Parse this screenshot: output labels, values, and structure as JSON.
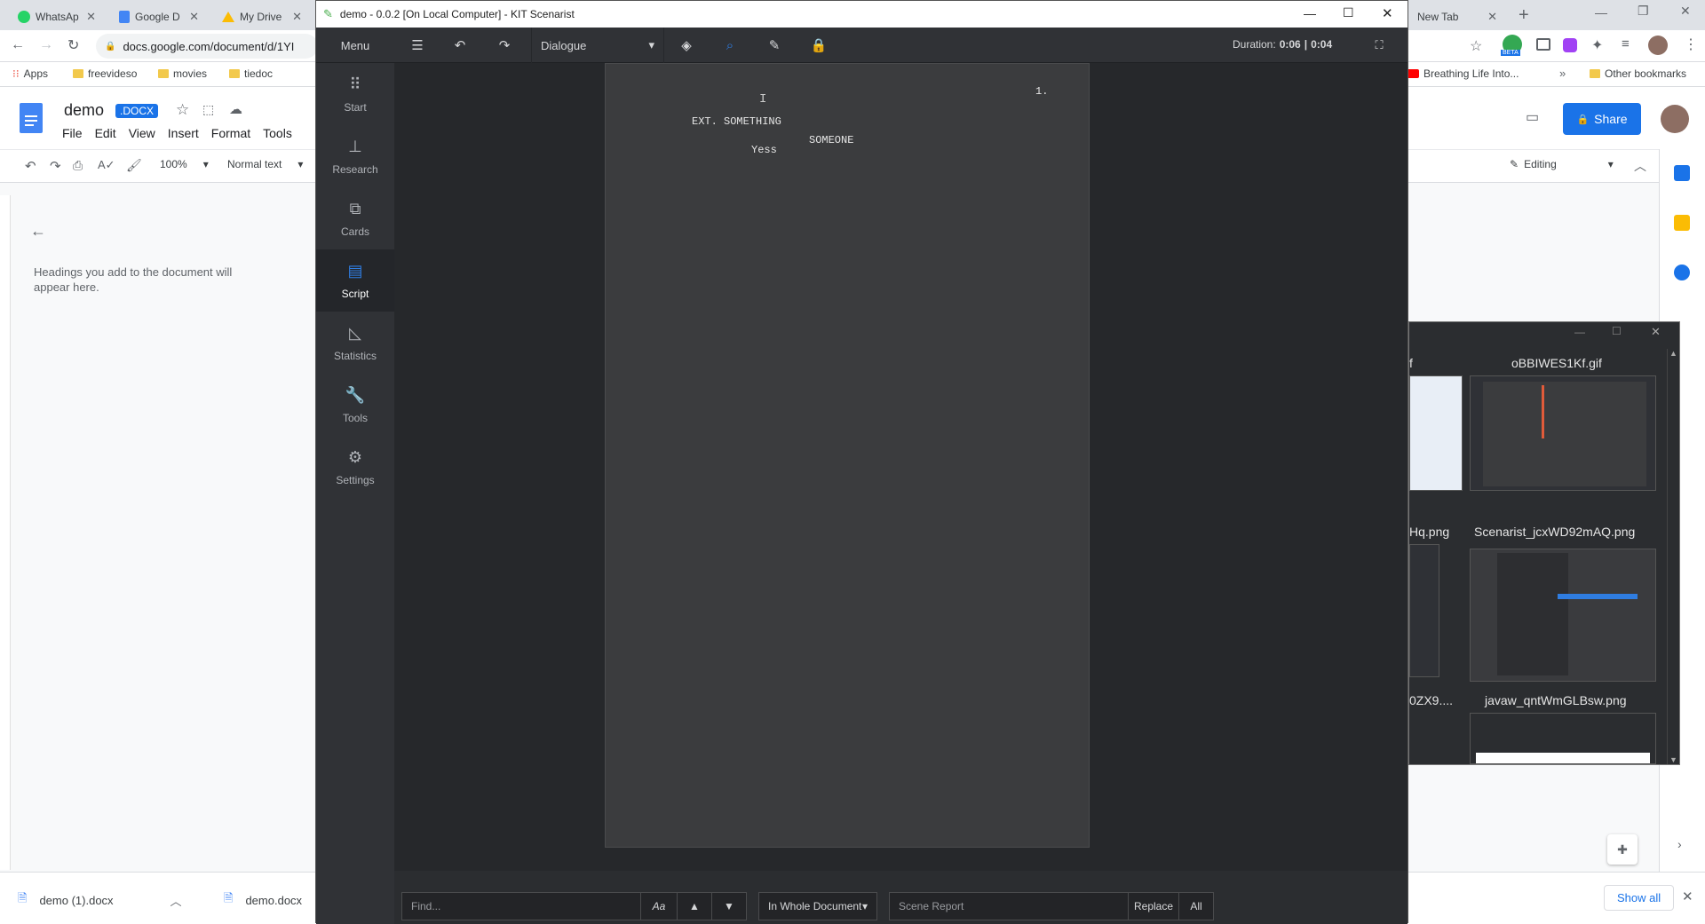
{
  "browser": {
    "tabs": [
      {
        "label": "WhatsAp",
        "color": "#25d366"
      },
      {
        "label": "Google D",
        "color": "#4285f4"
      },
      {
        "label": "My Drive",
        "color": "#fbbc04"
      },
      {
        "label": "New Tab",
        "color": "#9aa0a6"
      }
    ],
    "url": "docs.google.com/document/d/1YI",
    "bookmarks": [
      "Apps",
      "freevideso",
      "movies",
      "tiedoc"
    ],
    "bookmark_right": "Breathing Life Into...",
    "other_bookmarks": "Other bookmarks",
    "beta_badge": "BETA"
  },
  "docs": {
    "title": "demo",
    "ext_badge": ".DOCX",
    "menu": [
      "File",
      "Edit",
      "View",
      "Insert",
      "Format",
      "Tools"
    ],
    "zoom": "100%",
    "style": "Normal text",
    "share_label": "Share",
    "editing_label": "Editing",
    "outline_hint": "Headings you add to the document will appear here."
  },
  "downloads": {
    "items": [
      "demo (1).docx",
      "demo.docx"
    ],
    "show_all": "Show all"
  },
  "kit": {
    "title": "demo - 0.0.2 [On Local Computer] - KIT Scenarist",
    "menu_label": "Menu",
    "block_type": "Dialogue",
    "duration_label": "Duration:",
    "duration_a": "0:06",
    "duration_sep": "|",
    "duration_b": "0:04",
    "sidebar": [
      {
        "label": "Start",
        "icon": "grid-icon"
      },
      {
        "label": "Research",
        "icon": "sitemap-icon"
      },
      {
        "label": "Cards",
        "icon": "cards-icon"
      },
      {
        "label": "Script",
        "icon": "script-icon"
      },
      {
        "label": "Statistics",
        "icon": "chart-icon"
      },
      {
        "label": "Tools",
        "icon": "wrench-icon"
      },
      {
        "label": "Settings",
        "icon": "gear-icon"
      }
    ],
    "page_number": "1.",
    "scene_heading": "EXT. SOMETHING",
    "character": "SOMEONE",
    "dialogue": "Yess",
    "find_placeholder": "Find...",
    "case_btn": "Aa",
    "scope": "In Whole Document",
    "replace_placeholder": "Scene Report",
    "replace_btn": "Replace",
    "all_btn": "All",
    "accent": "#2f7de1"
  },
  "imgwin": {
    "captions": [
      "f",
      "oBBIWES1Kf.gif",
      "Hq.png",
      "Scenarist_jcxWD92mAQ.png",
      "0ZX9....",
      "javaw_qntWmGLBsw.png"
    ]
  }
}
